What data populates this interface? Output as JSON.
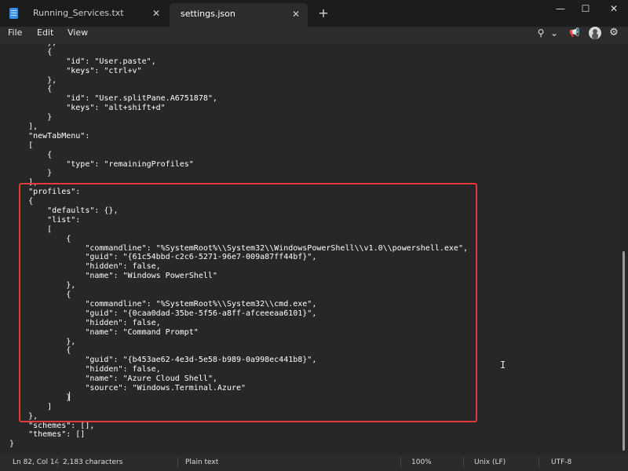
{
  "tabs": [
    {
      "label": "Running_Services.txt",
      "close": "✕"
    },
    {
      "label": "settings.json",
      "close": "✕"
    }
  ],
  "new_tab": "+",
  "window_controls": {
    "minimize": "—",
    "maximize": "☐",
    "close": "✕"
  },
  "menu": [
    {
      "label": "File"
    },
    {
      "label": "Edit"
    },
    {
      "label": "View"
    }
  ],
  "menubar_icons": {
    "copilot": "⚲",
    "dropdown": "⌄",
    "megaphone": "📢",
    "gear": "⚙"
  },
  "code_lines": [
    "        },",
    "        {",
    "            \"id\": \"User.paste\",",
    "            \"keys\": \"ctrl+v\"",
    "        },",
    "        {",
    "            \"id\": \"User.splitPane.A6751878\",",
    "            \"keys\": \"alt+shift+d\"",
    "        }",
    "    ],",
    "    \"newTabMenu\":",
    "    [",
    "        {",
    "            \"type\": \"remainingProfiles\"",
    "        }",
    "    ],",
    "    \"profiles\":",
    "    {",
    "        \"defaults\": {},",
    "        \"list\":",
    "        [",
    "            {",
    "                \"commandline\": \"%SystemRoot%\\\\System32\\\\WindowsPowerShell\\\\v1.0\\\\powershell.exe\",",
    "                \"guid\": \"{61c54bbd-c2c6-5271-96e7-009a87ff44bf}\",",
    "                \"hidden\": false,",
    "                \"name\": \"Windows PowerShell\"",
    "            },",
    "            {",
    "                \"commandline\": \"%SystemRoot%\\\\System32\\\\cmd.exe\",",
    "                \"guid\": \"{0caa0dad-35be-5f56-a8ff-afceeeaa6101}\",",
    "                \"hidden\": false,",
    "                \"name\": \"Command Prompt\"",
    "            },",
    "            {",
    "                \"guid\": \"{b453ae62-4e3d-5e58-b989-0a998ec441b8}\",",
    "                \"hidden\": false,",
    "                \"name\": \"Azure Cloud Shell\",",
    "                \"source\": \"Windows.Terminal.Azure\"",
    "            }",
    "        ]",
    "    },",
    "    \"schemes\": [],",
    "    \"themes\": []",
    "}"
  ],
  "ibeam_cursor": "I",
  "status": {
    "position": "Ln 82, Col 14",
    "characters": "2,183 characters",
    "format": "Plain text",
    "zoom": "100%",
    "line_ending": "Unix (LF)",
    "encoding": "UTF-8"
  },
  "colors": {
    "highlight_border": "#e03a3a",
    "accent": "#3a8ee6"
  }
}
